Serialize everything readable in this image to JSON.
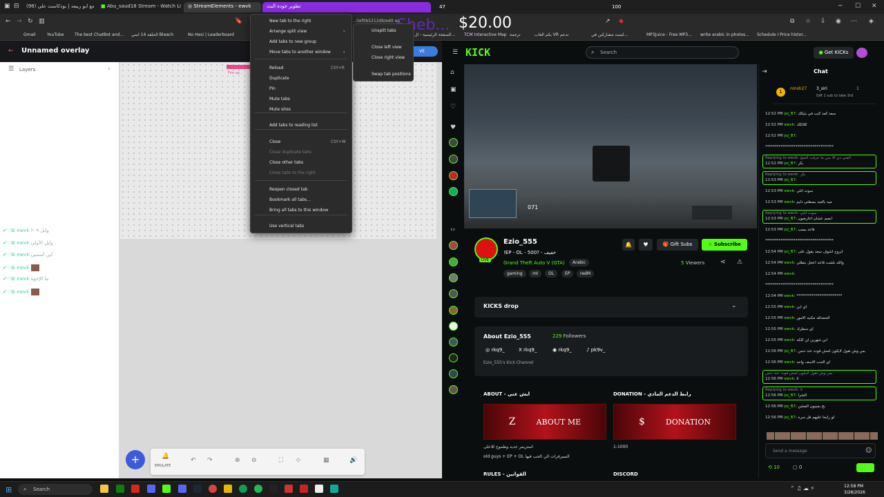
{
  "tabs": [
    {
      "label": "(98) سوالف مع ابو ربيعه | بودكاست علي",
      "active": false
    },
    {
      "label": "Abu_saud18 Stream - Watch Live on Kick",
      "active": false
    },
    {
      "label": "StreamElements - ewvk",
      "active": true
    },
    {
      "label": "تطوير جودة البث",
      "active": false
    }
  ],
  "overlay_numbers": {
    "left": "47",
    "right": "100"
  },
  "address": {
    "url": "…0ef0b5212db/edit ep",
    "donation_overlay": "$20.00",
    "overlay_name": "Sheb..."
  },
  "bookmarks": [
    "Gmail",
    "YouTube",
    "The best ChatBot and...",
    "الحلقة 14 انمي Bleach",
    "No Hesi | Leaderboard",
    "الصفحة الرئيسية - ال...",
    "TCM Interactive Map",
    "ترجمة",
    "بكم العاب VR تدعم",
    "لست مشاركين في...",
    "MP3Juice - Free MP3...",
    "write arabic in photos...",
    "Schedule I Price histor..."
  ],
  "editor": {
    "title": "Unnamed overlay",
    "layers_label": "Layers",
    "emulate_label": "EMULATE",
    "save_badge": "VE",
    "layer_chip": "Fire up..."
  },
  "left_chat": [
    {
      "user": "ewvk",
      "text": "وايل ٢٠٩"
    },
    {
      "user": "ewvk",
      "text": "وايل الأولى"
    },
    {
      "user": "ewvk",
      "text": "اين اسميي"
    },
    {
      "user": "ewvk",
      "text": ""
    },
    {
      "user": "ewvk",
      "text": "ما الإخوة"
    },
    {
      "user": "ewvk",
      "text": ""
    }
  ],
  "context_menu": {
    "items": [
      {
        "label": "New tab to the right",
        "shortcut": "",
        "disabled": false
      },
      {
        "label": "Arrange split view",
        "shortcut": "",
        "disabled": false,
        "submenu": true
      },
      {
        "label": "Add tabs to new group",
        "shortcut": "",
        "disabled": false
      },
      {
        "label": "Move tabs to another window",
        "shortcut": "",
        "disabled": false,
        "submenu": true
      },
      {
        "label": "Reload",
        "shortcut": "Ctrl+R",
        "disabled": false
      },
      {
        "label": "Duplicate",
        "shortcut": "",
        "disabled": false
      },
      {
        "label": "Pin",
        "shortcut": "",
        "disabled": false
      },
      {
        "label": "Mute tabs",
        "shortcut": "",
        "disabled": false
      },
      {
        "label": "Mute sites",
        "shortcut": "",
        "disabled": false
      },
      {
        "label": "Add tabs to reading list",
        "shortcut": "",
        "disabled": false
      },
      {
        "label": "Close",
        "shortcut": "Ctrl+W",
        "disabled": false
      },
      {
        "label": "Close duplicate tabs",
        "shortcut": "",
        "disabled": true
      },
      {
        "label": "Close other tabs",
        "shortcut": "",
        "disabled": false
      },
      {
        "label": "Close tabs to the right",
        "shortcut": "",
        "disabled": true
      },
      {
        "label": "Reopen closed tab",
        "shortcut": "",
        "disabled": false
      },
      {
        "label": "Bookmark all tabs...",
        "shortcut": "",
        "disabled": false
      },
      {
        "label": "Bring all tabs to this window",
        "shortcut": "",
        "disabled": false
      },
      {
        "label": "Use vertical tabs",
        "shortcut": "",
        "disabled": false
      }
    ],
    "submenu": [
      "Unsplit tabs",
      "Close left view",
      "Close right view",
      "Swap tab positions"
    ]
  },
  "kick": {
    "logo": "KICK",
    "search_placeholder": "Search",
    "get_kicks": "Get KICKs",
    "streamer": "Ezio_555",
    "stream_title": "!EP - OL - 500? - خفيف",
    "category": "Grand Theft Auto V (GTA)",
    "language": "Arabic",
    "tags": [
      "gaming",
      "mt",
      "OL",
      "EP",
      "redM"
    ],
    "viewers": "5",
    "viewers_label": "Viewers",
    "gift_subs": "Gift Subs",
    "subscribe": "Subscribe",
    "live_badge": "LIVE",
    "kicks_drop": "KICKS drop",
    "about_title": "About Ezio_555",
    "followers_count": "229",
    "followers_label": "Followers",
    "socials": [
      "rkq9_",
      "rkq9_",
      "rkq9_",
      "pk9v_"
    ],
    "channel_desc": "Ezio_555's Kick Channel",
    "about_panel_title": "ABOUT - ايش عني",
    "about_banner": "ABOUT ME",
    "about_text_1": "استريمر جديد وطموح للاعلى",
    "about_text_2": "old guys + EP + OL السيرفرات الي الحب فيها",
    "donation_title": "DONATION - رابط الدعم المادي",
    "donation_banner": "DONATION",
    "donation_text": "1-1000",
    "rules_title": "RULES - القوانين",
    "discord_title": "DISCORD",
    "hud_speed": "071"
  },
  "chat": {
    "title": "Chat",
    "top_gifter": "nmsh27",
    "top_gifter_2": "3_siri",
    "top_gifter_2_count": "1",
    "gift_hint": "Gift 1 sub to take 3rd",
    "messages": [
      {
        "time": "12:52 PM",
        "user": "joj_B7",
        "text": "سعد كعد كتب في بثيكك"
      },
      {
        "time": "12:52 PM",
        "user": "ewvk",
        "text": "كلالكك"
      },
      {
        "time": "12:52 PM",
        "user": "joj_B7",
        "text": ""
      },
      {
        "time": "",
        "user": "",
        "text": "************************************"
      },
      {
        "time": "12:52 PM",
        "user": "joj_B7",
        "text": "بكر",
        "reply": "Replying to ewvk: الفتي دي الا بس ما عرفت الشخ"
      },
      {
        "time": "12:53 PM",
        "user": "joj_B7",
        "text": "",
        "reply": "Replying to ewvk: بكر"
      },
      {
        "time": "12:53 PM",
        "user": "ewvk",
        "text": "سوت اتلي"
      },
      {
        "time": "12:53 PM",
        "user": "ewvk",
        "text": "ميه بالعيه بسطني دايم"
      },
      {
        "time": "12:53 PM",
        "user": "joj_B7",
        "text": "ابصم عشان أعارضون",
        "reply": "Replying to ewvk: سوت اتلي"
      },
      {
        "time": "12:53 PM",
        "user": "joj_B7",
        "text": "قاعد يسب"
      },
      {
        "time": "",
        "user": "",
        "text": "************************************"
      },
      {
        "time": "12:54 PM",
        "user": "joj_B7",
        "text": "ابروح اشوف سعد يقول على"
      },
      {
        "time": "12:54 PM",
        "user": "ewvk",
        "text": "والله بلشت قاعد اعجل بتطلي"
      },
      {
        "time": "12:54 PM",
        "user": "ewvk",
        "text": ""
      },
      {
        "time": "",
        "user": "",
        "text": "************************************"
      },
      {
        "time": "12:54 PM",
        "user": "ewvk",
        "text": "************************"
      },
      {
        "time": "12:55 PM",
        "user": "ewvk",
        "text": "اي ابن"
      },
      {
        "time": "12:55 PM",
        "user": "ewvk",
        "text": "الحمدلله مكنيه الامور"
      },
      {
        "time": "12:55 PM",
        "user": "ewvk",
        "text": "اي سطرك"
      },
      {
        "time": "12:55 PM",
        "user": "ewvk",
        "text": "ابن شهرين لن كلكه"
      },
      {
        "time": "12:56 PM",
        "user": "joj_B7",
        "text": "بس وش تقول لايكون لحش قوت عند دنس"
      },
      {
        "time": "12:56 PM",
        "user": "ewvk",
        "text": "اي الحب الاسف واحد"
      },
      {
        "time": "12:56 PM",
        "user": "ewvk",
        "text": "لا",
        "reply": "بس وش تقول لايكون لحش قوت عند دنس"
      },
      {
        "time": "12:56 PM",
        "user": "joj_B7",
        "text": "الشرا",
        "reply": "Replying to ewvk: لا"
      },
      {
        "time": "12:56 PM",
        "user": "joj_B7",
        "text": "بح بجيبون المشن"
      },
      {
        "time": "12:56 PM",
        "user": "joj_B7",
        "text": "لو رايحا عليهم فل سره"
      }
    ],
    "input_placeholder": "Send a message",
    "points": "10",
    "second_count": "0"
  },
  "taskbar": {
    "search": "Search",
    "time": "12:58 PM",
    "date": "3/26/2026"
  },
  "colors": {
    "kick_green": "#53fc18",
    "chat_bg": "#0b0e0f",
    "banner_red": "#b3121b",
    "overlay_purple": "#8a2be2"
  }
}
